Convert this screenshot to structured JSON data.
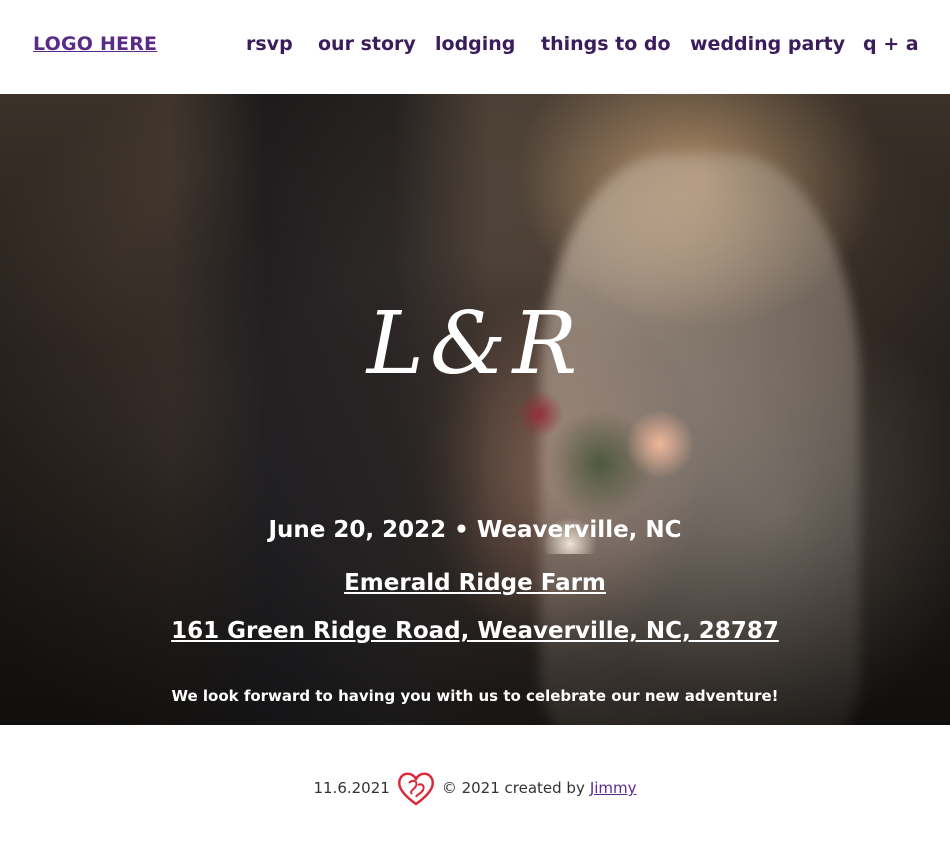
{
  "header": {
    "logo": "LOGO HERE",
    "nav": [
      {
        "label": "rsvp"
      },
      {
        "label": "our story"
      },
      {
        "label": "lodging"
      },
      {
        "label": "things to do"
      },
      {
        "label": "wedding party"
      },
      {
        "label": "q + a"
      }
    ]
  },
  "hero": {
    "monogram": "L&R",
    "date_location": "June 20, 2022 • Weaverville, NC",
    "venue": "Emerald Ridge Farm",
    "address": "161 Green Ridge Road, Weaverville, NC, 28787",
    "tagline": "We look forward to having you with us to celebrate our new adventure!"
  },
  "footer": {
    "date": "11.6.2021",
    "credit": "© 2021 created by",
    "author": "Jimmy",
    "heart_icon": "heart-monogram-icon"
  },
  "colors": {
    "accent": "#5b2a86",
    "nav_text": "#3b1d5c",
    "heart": "#d62d3a"
  }
}
